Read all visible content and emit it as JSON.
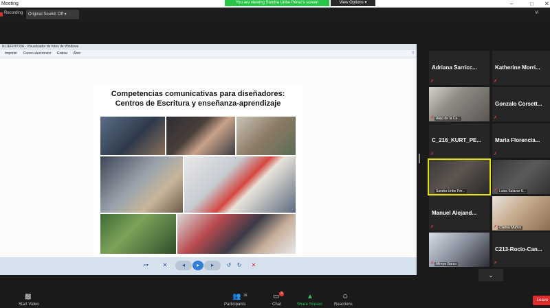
{
  "window": {
    "title": "Meeting",
    "share_banner": "You are viewing Sandra Uribe Pérez's screen",
    "view_options": "View Options",
    "controls": [
      "–",
      "□",
      "✕"
    ]
  },
  "toolbar": {
    "recording_label": "Recording",
    "original_sound": "Original Sound: Off",
    "view_label": "Vi"
  },
  "viewer": {
    "title": "N DEFINITIVA - Visualizador de fotos de Windows",
    "menu": [
      "Imprimir",
      "Correo electrónico",
      "Grabar",
      "Abrir"
    ],
    "slide_title_line1": "Competencias comunicativas para diseñadores:",
    "slide_title_line2": "Centros de Escritura y enseñanza-aprendizaje"
  },
  "participants": [
    {
      "name": "Adriana Sarricc...",
      "video": false,
      "muted": true
    },
    {
      "name": "Katherine Morri...",
      "video": false,
      "muted": true
    },
    {
      "name": "Alejo de la Ca...",
      "video": true,
      "muted": true
    },
    {
      "name": "Gonzalo Corsett...",
      "video": false,
      "muted": true
    },
    {
      "name": "C_216_KURT_PE...",
      "video": false,
      "muted": true
    },
    {
      "name": "Maria Florencia...",
      "video": false,
      "muted": true
    },
    {
      "name": "Sandra Uribe Pér...",
      "video": true,
      "muted": false
    },
    {
      "name": "Luisa Salazar S...",
      "video": true,
      "muted": true
    },
    {
      "name": "Manuel Alejand...",
      "video": false,
      "muted": true
    },
    {
      "name": "Clarina Muñoz",
      "video": true,
      "muted": true
    },
    {
      "name": "Mireya Garza",
      "video": true,
      "muted": true
    },
    {
      "name": "C213-Rocio-Can...",
      "video": false,
      "muted": true
    }
  ],
  "bottom": {
    "start_video": "Start Video",
    "participants": "Participants",
    "participants_count": "36",
    "chat": "Chat",
    "chat_badge": "3",
    "share_screen": "Share Screen",
    "reactions": "Reactions",
    "leave": "Leave"
  },
  "colors": {
    "share_green": "#27c447",
    "leave_red": "#e02e2e",
    "active_speaker": "#e6e600"
  }
}
